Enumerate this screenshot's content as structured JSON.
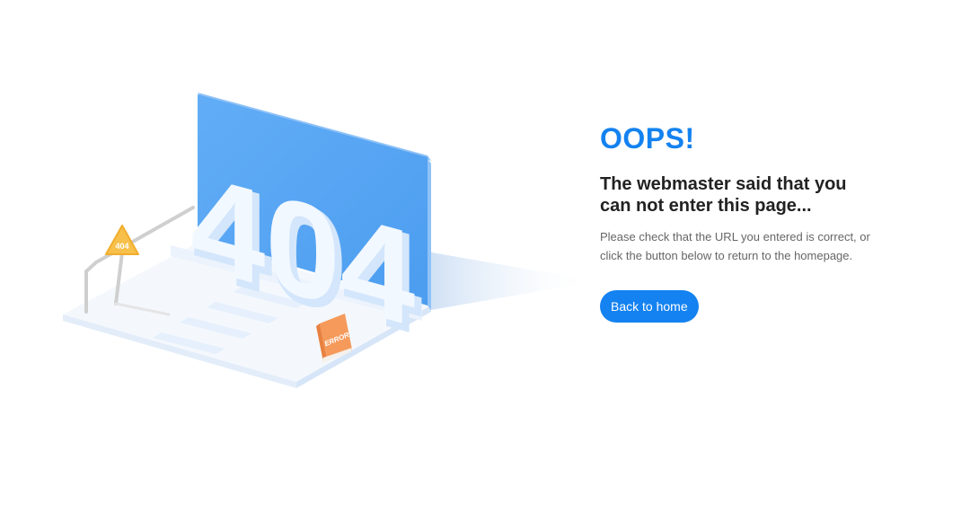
{
  "illustration": {
    "screen_text": "404",
    "warning_sign_text": "404",
    "error_board_text": "ERROR",
    "colors": {
      "screen": "#5aa8f5",
      "screen_edge": "#8fc2f7",
      "keyboard": "#f4f8fd",
      "warning_sign": "#f7c04a",
      "error_board": "#f59a5a"
    }
  },
  "message": {
    "title": "OOPS!",
    "headline": "The webmaster said that you can not enter this page...",
    "info": "Please check that the URL you entered is correct, or click the button below to return to the homepage."
  },
  "actions": {
    "home_label": "Back to home"
  },
  "theme": {
    "accent": "#1482f0",
    "headline_color": "#222222",
    "info_color": "#666666"
  }
}
